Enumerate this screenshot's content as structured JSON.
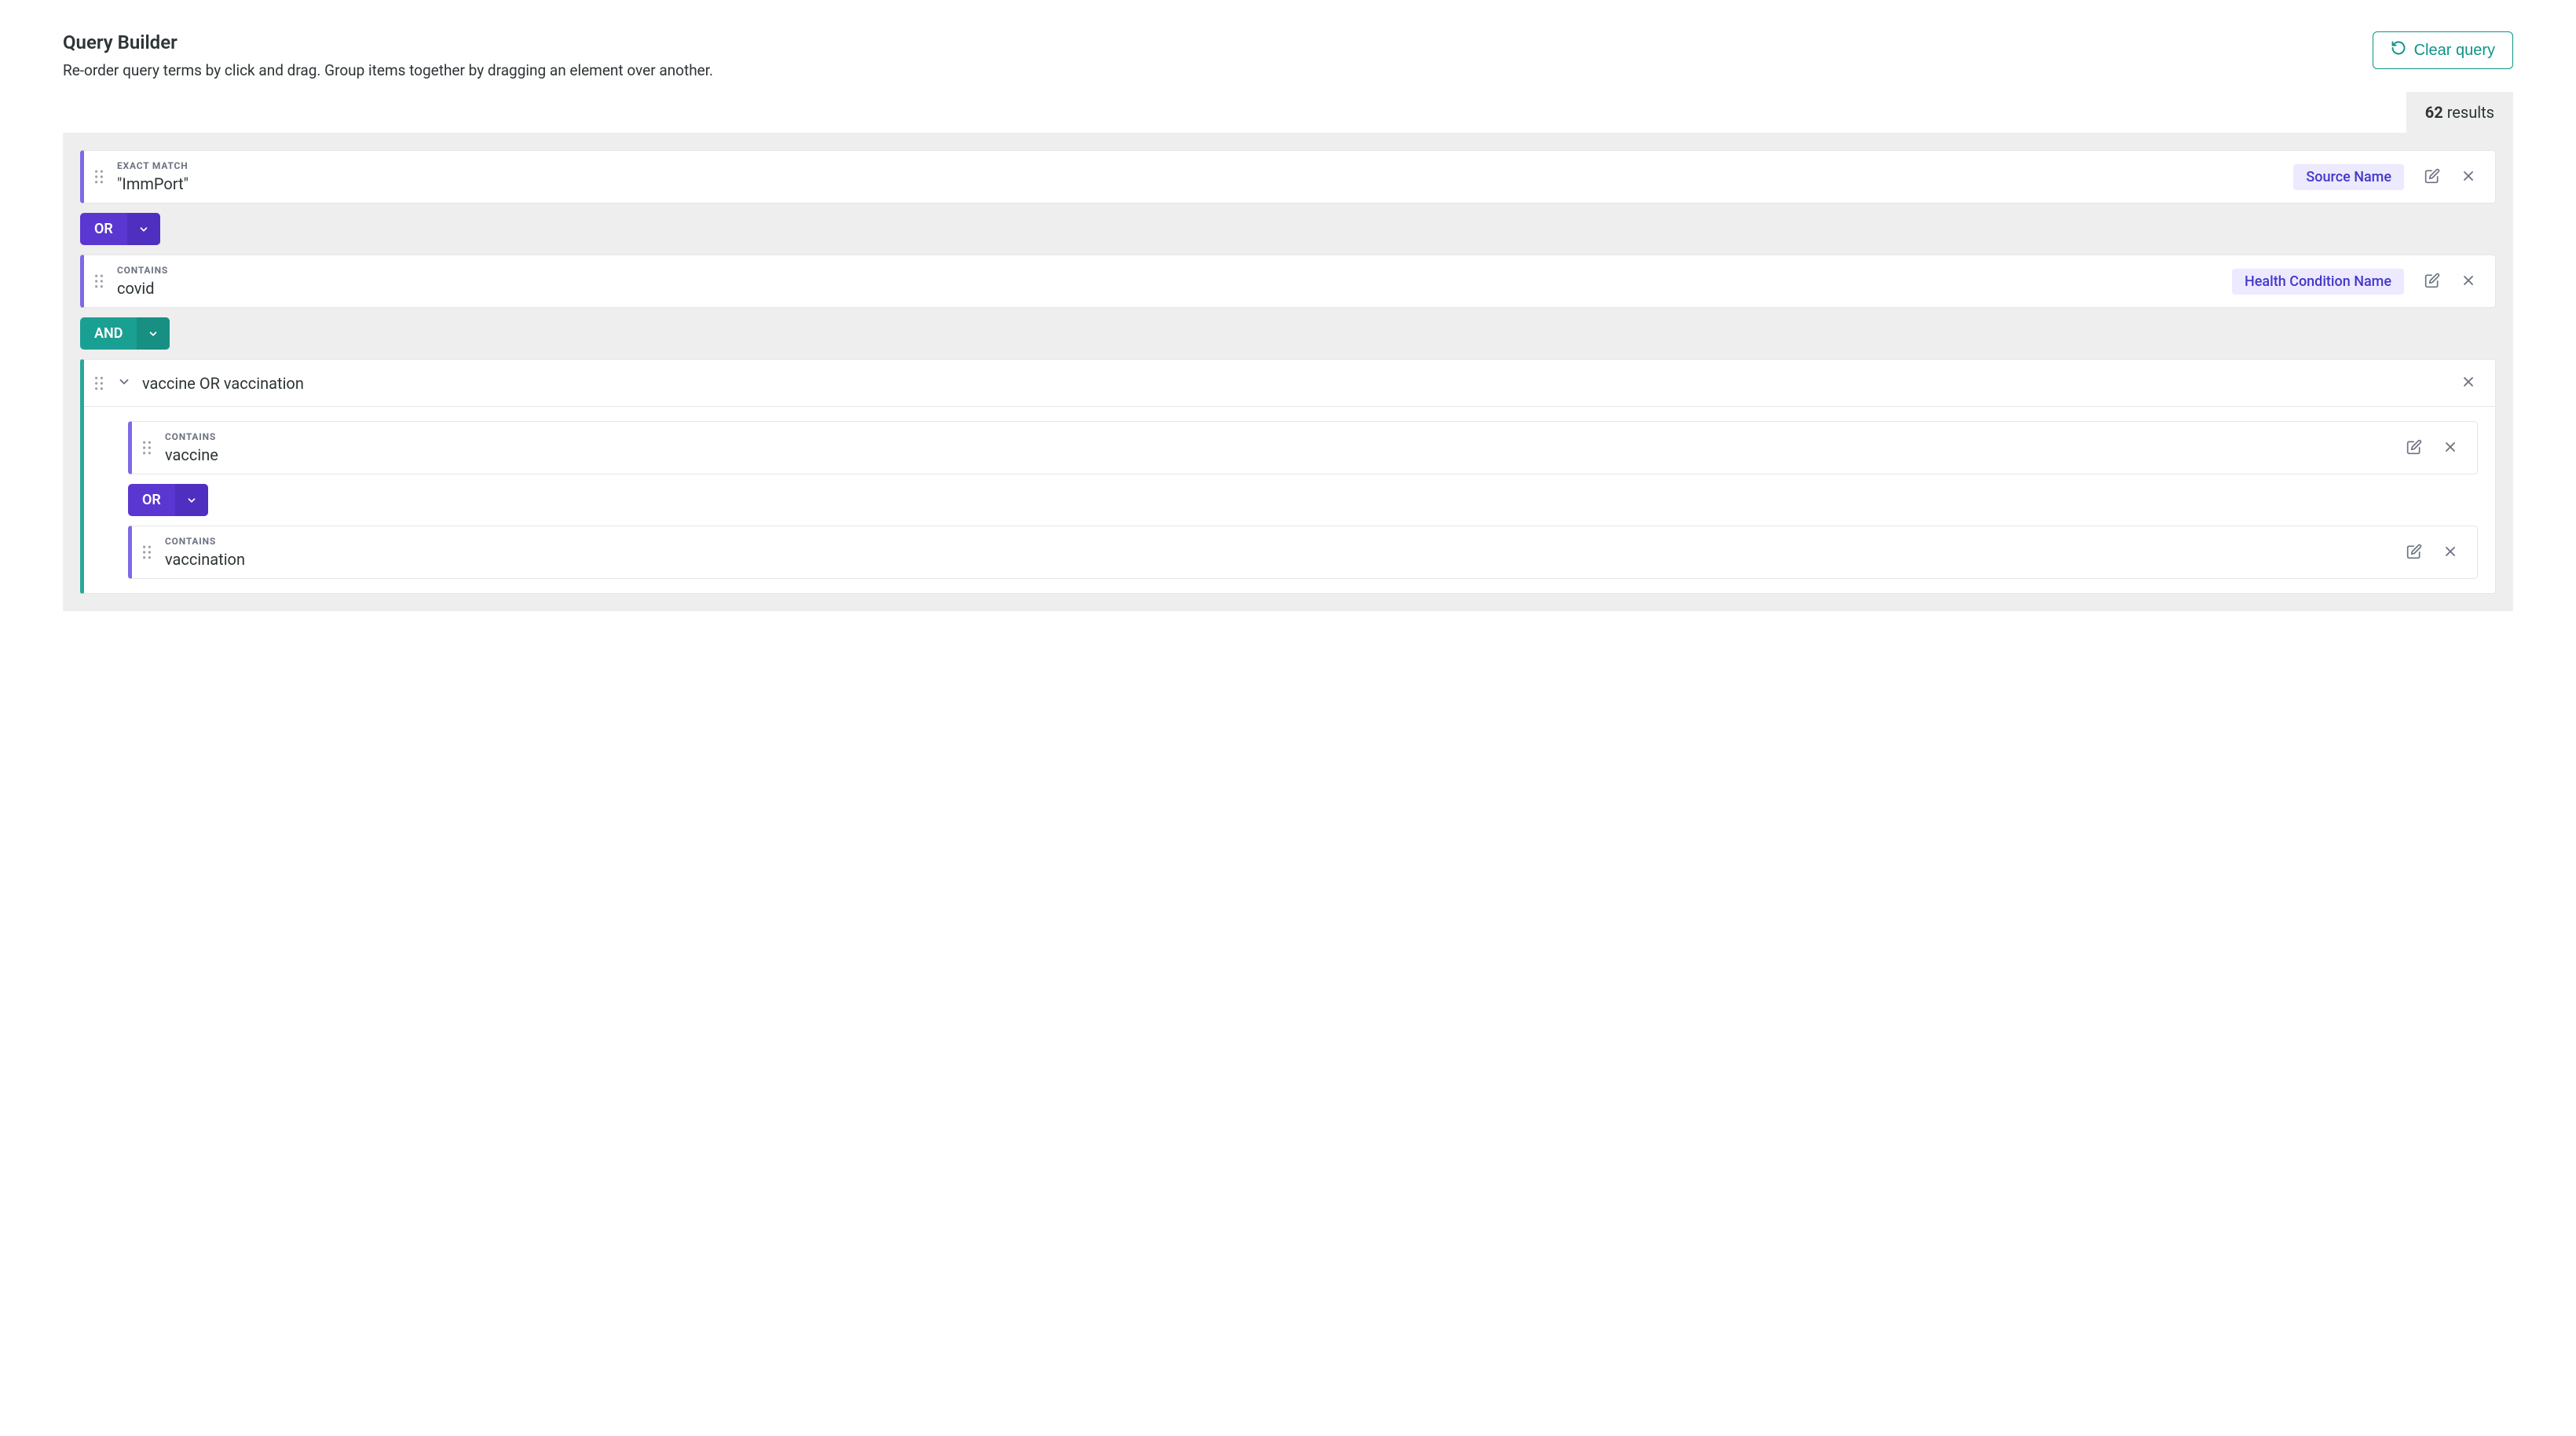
{
  "header": {
    "title": "Query Builder",
    "subtitle": "Re-order query terms by click and drag. Group items together by dragging an element over another.",
    "clear_label": "Clear query"
  },
  "results": {
    "count": "62",
    "label": "results"
  },
  "terms": {
    "t1": {
      "match_type": "EXACT MATCH",
      "value": "\"ImmPort\"",
      "field": "Source Name"
    },
    "t2": {
      "match_type": "CONTAINS",
      "value": "covid",
      "field": "Health Condition Name"
    }
  },
  "ops": {
    "or_label": "OR",
    "and_label": "AND"
  },
  "group": {
    "summary": "vaccine OR vaccination",
    "items": {
      "g1": {
        "match_type": "CONTAINS",
        "value": "vaccine"
      },
      "g2": {
        "match_type": "CONTAINS",
        "value": "vaccination"
      }
    },
    "inner_op": "OR"
  }
}
